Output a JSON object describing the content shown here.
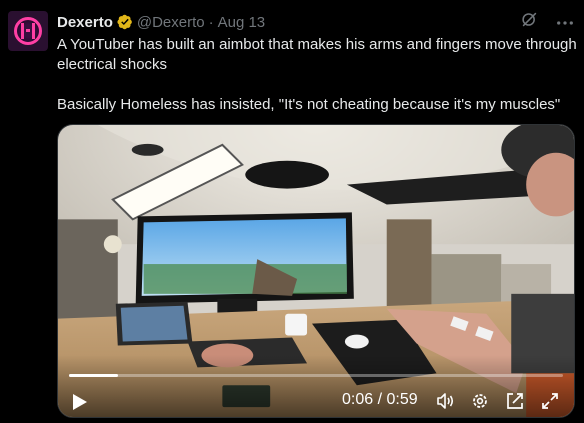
{
  "tweet": {
    "author_name": "Dexerto",
    "handle": "@Dexerto",
    "separator": "·",
    "date": "Aug 13",
    "text_line1": "A YouTuber has built an aimbot that makes his arms and fingers move through electrical shocks",
    "text_line2": "Basically Homeless has insisted, \"It's not cheating because it's my muscles\""
  },
  "video": {
    "current_time": "0:06",
    "time_separator": "/",
    "duration": "0:59",
    "time_display": "0:06 / 0:59",
    "progress_fraction": 0.1
  },
  "icons": {
    "avatar": "dexerto-logo",
    "verified": "verified-badge-icon",
    "grok": "grok-icon",
    "more": "more-icon",
    "play": "play-icon",
    "volume": "volume-icon",
    "settings": "settings-icon",
    "pip": "picture-in-picture-icon",
    "fullscreen": "fullscreen-icon"
  },
  "colors": {
    "background": "#000000",
    "text": "#e7e9ea",
    "muted": "#71767b",
    "verified_gold": "#e2b719",
    "brand_pink": "#ff3fa4"
  }
}
